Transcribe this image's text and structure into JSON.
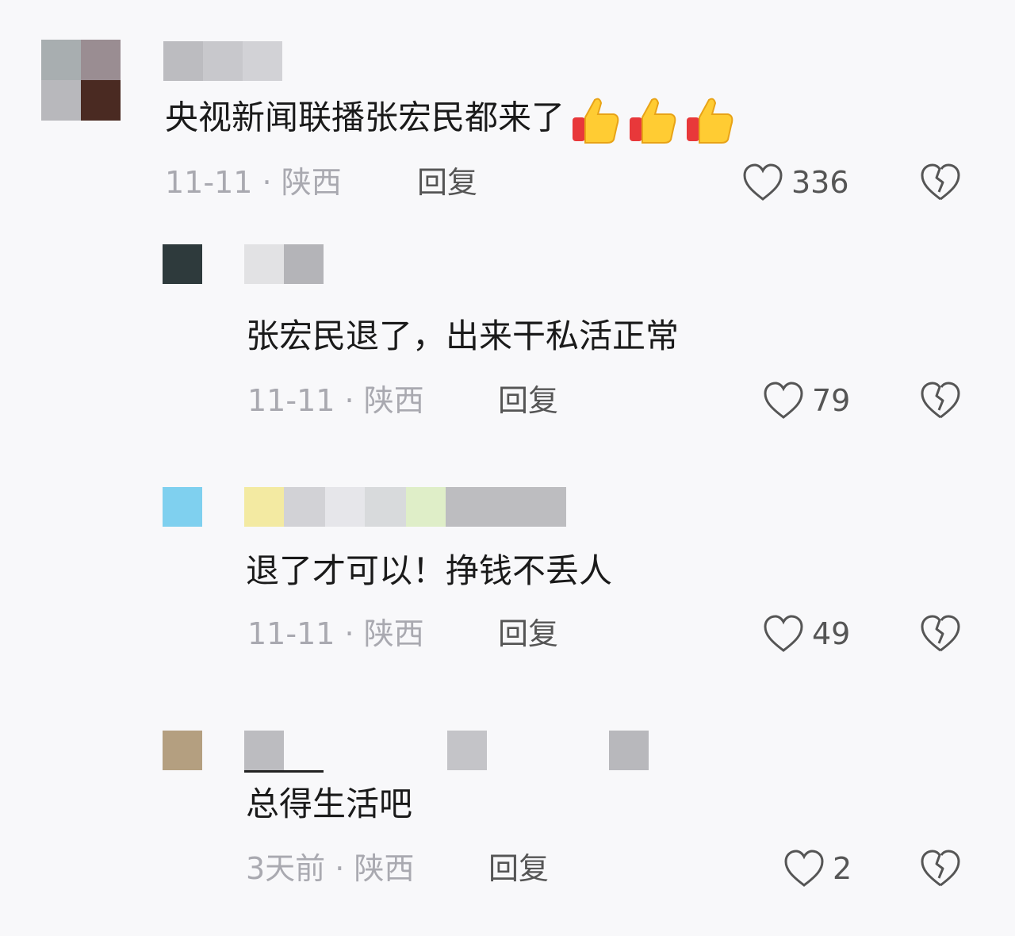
{
  "comments": [
    {
      "text": "央视新闻联播张宏民都来了",
      "date": "11-11",
      "location": "陕西",
      "reply_label": "回复",
      "likes": "336",
      "emoji": "thumbs-up-icon"
    },
    {
      "text": "张宏民退了，出来干私活正常",
      "date": "11-11",
      "location": "陕西",
      "reply_label": "回复",
      "likes": "79"
    },
    {
      "text": "退了才可以！挣钱不丢人",
      "date": "11-11",
      "location": "陕西",
      "reply_label": "回复",
      "likes": "49"
    },
    {
      "text": "总得生活吧",
      "date": "3天前",
      "location": "陕西",
      "reply_label": "回复",
      "likes": "2"
    }
  ],
  "meta_separator": "·",
  "colors": {
    "background": "#f8f8fa",
    "text": "#1a1a1a",
    "meta_gray": "#a9a9b0",
    "icon_stroke": "#555555"
  }
}
